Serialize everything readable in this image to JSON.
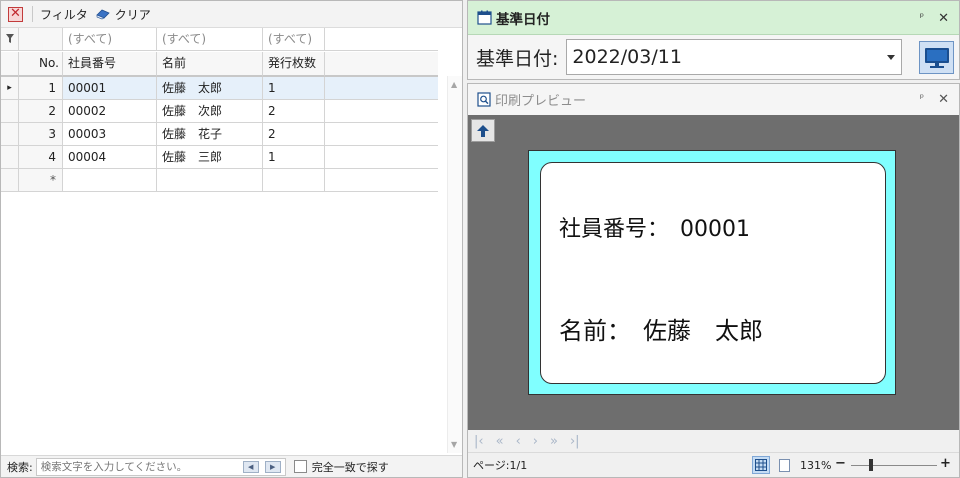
{
  "toolbar": {
    "filter_label": "フィルタ",
    "clear_label": "クリア"
  },
  "grid": {
    "filter_row": [
      "(すべて)",
      "(すべて)",
      "(すべて)"
    ],
    "columns": [
      "No.",
      "社員番号",
      "名前",
      "発行枚数"
    ],
    "rows": [
      {
        "no": "1",
        "emp_id": "00001",
        "name": "佐藤　太郎",
        "count": "1"
      },
      {
        "no": "2",
        "emp_id": "00002",
        "name": "佐藤　次郎",
        "count": "2"
      },
      {
        "no": "3",
        "emp_id": "00003",
        "name": "佐藤　花子",
        "count": "2"
      },
      {
        "no": "4",
        "emp_id": "00004",
        "name": "佐藤　三郎",
        "count": "1"
      }
    ],
    "new_row_marker": "*",
    "current_row_marker": "▸"
  },
  "search": {
    "label": "検索:",
    "placeholder": "検索文字を入力してください。",
    "exact_match_label": "完全一致で探す"
  },
  "date_pane": {
    "title": "基準日付",
    "field_label": "基準日付:",
    "value": "2022/03/11"
  },
  "preview_pane": {
    "title": "印刷プレビュー",
    "card_line1": "社員番号：　00001",
    "card_line2": "名前：　佐藤　太郎",
    "page_info": "ページ:1/1",
    "zoom": "131%",
    "zoom_minus": "−",
    "zoom_plus": "+"
  },
  "colors": {
    "date_header": "#d6f1d6",
    "page_background": "#80ffff",
    "canvas": "#6e6e6e"
  }
}
